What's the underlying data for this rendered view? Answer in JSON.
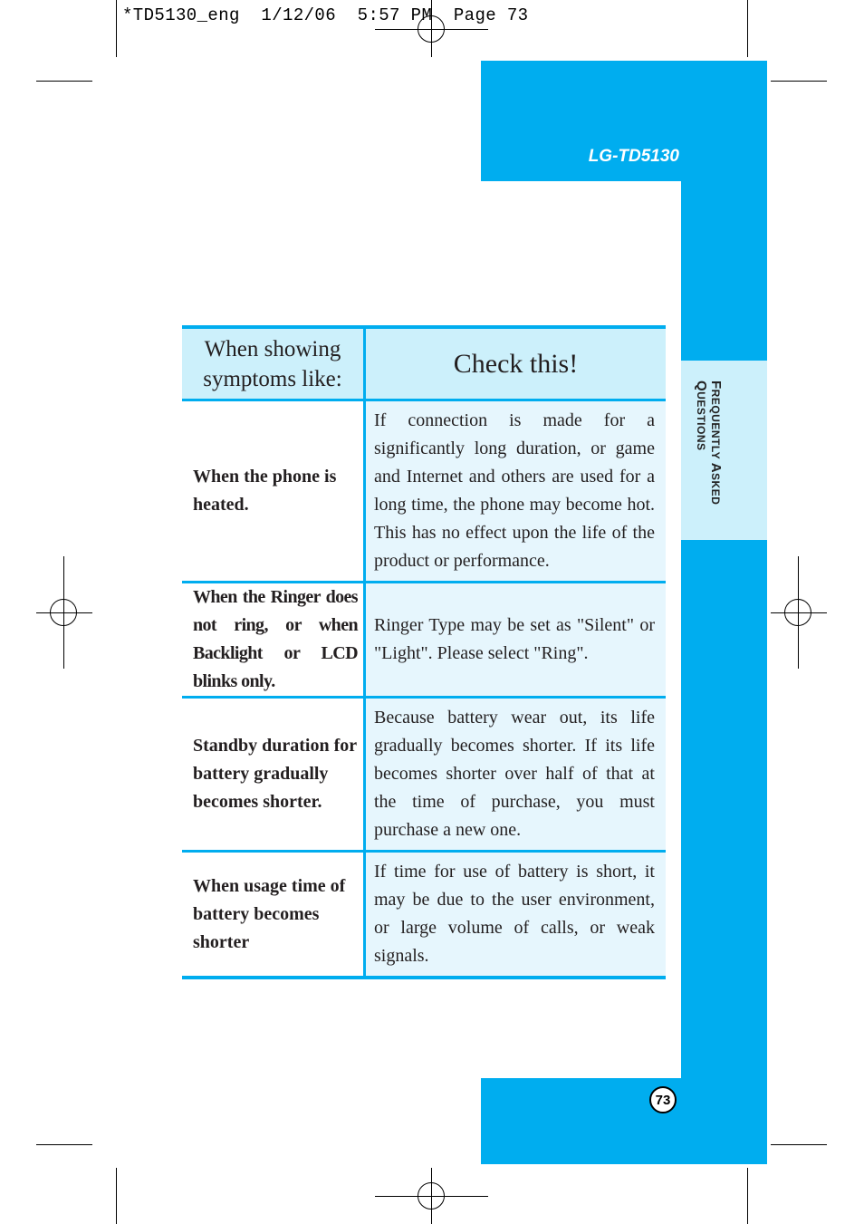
{
  "print_slug": "*TD5130_eng  1/12/06  5:57 PM  Page 73",
  "header": {
    "model": "LG-TD5130"
  },
  "side_tab": {
    "first_word_cap": "F",
    "first_word_rest": "REQUENTLY ",
    "second_word_cap": "A",
    "second_word_rest": "SKED",
    "third_word_cap": "Q",
    "third_word_rest": "UESTIONS"
  },
  "table": {
    "header_left": "When showing symptoms like:",
    "header_right": "Check this!",
    "rows": [
      {
        "symptom": "When the phone is heated.",
        "check": "If connection is made for a significantly long duration, or game and Internet and others are used for a long time, the phone may become hot. This has no effect upon the life of the product or performance."
      },
      {
        "symptom": "When the Ringer does not ring, or when Backlight or LCD blinks only.",
        "check": "Ringer Type may be set as \"Silent\" or \"Light\". Please select \"Ring\"."
      },
      {
        "symptom": "Standby duration for battery gradually becomes shorter.",
        "check": "Because battery wear out, its life gradually becomes shorter. If its life becomes shorter over half of that at the time of purchase, you must purchase a new one."
      },
      {
        "symptom": "When usage time of battery becomes shorter",
        "check": "If time for use of battery is short, it may be due to the user environment, or large volume of calls, or weak signals."
      }
    ]
  },
  "footer": {
    "page_number": "73"
  },
  "colors": {
    "accent": "#00adef",
    "light_accent": "#ccf0fb",
    "answer_bg": "#e6f6fd"
  }
}
